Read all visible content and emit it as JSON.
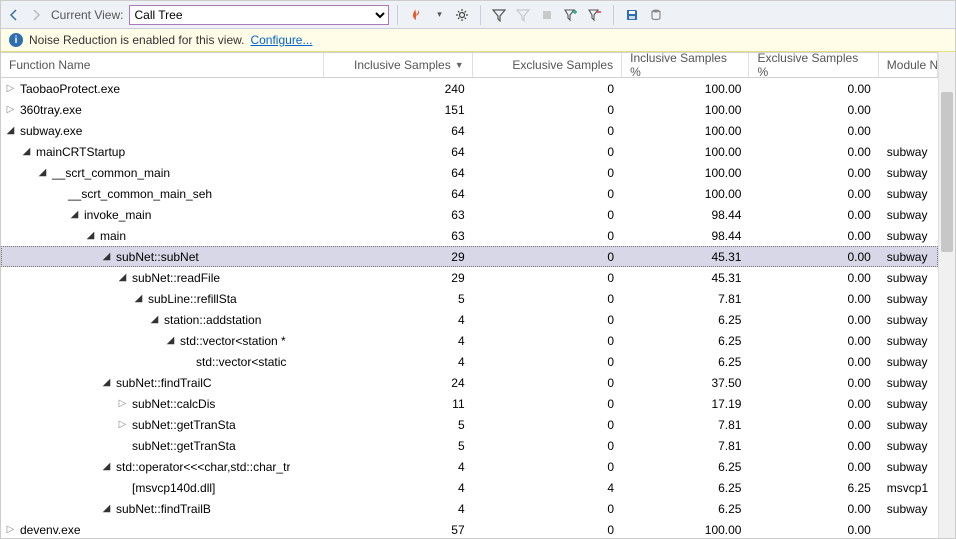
{
  "toolbar": {
    "current_view_label": "Current View:",
    "current_view_value": "Call Tree"
  },
  "notice": {
    "text": "Noise Reduction is enabled for this view.",
    "link": "Configure..."
  },
  "columns": {
    "fn": "Function Name",
    "inc": "Inclusive Samples",
    "exc": "Exclusive Samples",
    "incp": "Inclusive Samples %",
    "excp": "Exclusive Samples %",
    "mod": "Module N"
  },
  "rows": [
    {
      "depth": 0,
      "exp": "closed",
      "fn": "TaobaoProtect.exe",
      "inc": "240",
      "exc": "0",
      "incp": "100.00",
      "excp": "0.00",
      "mod": ""
    },
    {
      "depth": 0,
      "exp": "closed",
      "fn": "360tray.exe",
      "inc": "151",
      "exc": "0",
      "incp": "100.00",
      "excp": "0.00",
      "mod": ""
    },
    {
      "depth": 0,
      "exp": "open",
      "fn": "subway.exe",
      "inc": "64",
      "exc": "0",
      "incp": "100.00",
      "excp": "0.00",
      "mod": ""
    },
    {
      "depth": 1,
      "exp": "open",
      "fn": "mainCRTStartup",
      "inc": "64",
      "exc": "0",
      "incp": "100.00",
      "excp": "0.00",
      "mod": "subway"
    },
    {
      "depth": 2,
      "exp": "open",
      "fn": "__scrt_common_main",
      "inc": "64",
      "exc": "0",
      "incp": "100.00",
      "excp": "0.00",
      "mod": "subway"
    },
    {
      "depth": 3,
      "exp": "none",
      "fn": "__scrt_common_main_seh",
      "inc": "64",
      "exc": "0",
      "incp": "100.00",
      "excp": "0.00",
      "mod": "subway"
    },
    {
      "depth": 4,
      "exp": "open",
      "fn": "invoke_main",
      "inc": "63",
      "exc": "0",
      "incp": "98.44",
      "excp": "0.00",
      "mod": "subway"
    },
    {
      "depth": 5,
      "exp": "open",
      "fn": "main",
      "inc": "63",
      "exc": "0",
      "incp": "98.44",
      "excp": "0.00",
      "mod": "subway"
    },
    {
      "depth": 6,
      "exp": "open",
      "fn": "subNet::subNet",
      "inc": "29",
      "exc": "0",
      "incp": "45.31",
      "excp": "0.00",
      "mod": "subway",
      "sel": true
    },
    {
      "depth": 7,
      "exp": "open",
      "fn": "subNet::readFile",
      "inc": "29",
      "exc": "0",
      "incp": "45.31",
      "excp": "0.00",
      "mod": "subway"
    },
    {
      "depth": 8,
      "exp": "open",
      "fn": "subLine::refillSta",
      "inc": "5",
      "exc": "0",
      "incp": "7.81",
      "excp": "0.00",
      "mod": "subway"
    },
    {
      "depth": 9,
      "exp": "open",
      "fn": "station::addstation",
      "inc": "4",
      "exc": "0",
      "incp": "6.25",
      "excp": "0.00",
      "mod": "subway"
    },
    {
      "depth": 10,
      "exp": "open",
      "fn": "std::vector<station *",
      "inc": "4",
      "exc": "0",
      "incp": "6.25",
      "excp": "0.00",
      "mod": "subway"
    },
    {
      "depth": 11,
      "exp": "none",
      "fn": "std::vector<static",
      "inc": "4",
      "exc": "0",
      "incp": "6.25",
      "excp": "0.00",
      "mod": "subway"
    },
    {
      "depth": 6,
      "exp": "open",
      "fn": "subNet::findTrailC",
      "inc": "24",
      "exc": "0",
      "incp": "37.50",
      "excp": "0.00",
      "mod": "subway"
    },
    {
      "depth": 7,
      "exp": "closed",
      "fn": "subNet::calcDis",
      "inc": "11",
      "exc": "0",
      "incp": "17.19",
      "excp": "0.00",
      "mod": "subway"
    },
    {
      "depth": 7,
      "exp": "closed",
      "fn": "subNet::getTranSta",
      "inc": "5",
      "exc": "0",
      "incp": "7.81",
      "excp": "0.00",
      "mod": "subway"
    },
    {
      "depth": 7,
      "exp": "none",
      "fn": "subNet::getTranSta",
      "inc": "5",
      "exc": "0",
      "incp": "7.81",
      "excp": "0.00",
      "mod": "subway"
    },
    {
      "depth": 6,
      "exp": "open",
      "fn": "std::operator<<<char,std::char_tr",
      "inc": "4",
      "exc": "0",
      "incp": "6.25",
      "excp": "0.00",
      "mod": "subway"
    },
    {
      "depth": 7,
      "exp": "none",
      "fn": "[msvcp140d.dll]",
      "inc": "4",
      "exc": "4",
      "incp": "6.25",
      "excp": "6.25",
      "mod": "msvcp1"
    },
    {
      "depth": 6,
      "exp": "open",
      "fn": "subNet::findTrailB",
      "inc": "4",
      "exc": "0",
      "incp": "6.25",
      "excp": "0.00",
      "mod": "subway"
    },
    {
      "depth": 0,
      "exp": "closed",
      "fn": "devenv.exe",
      "inc": "57",
      "exc": "0",
      "incp": "100.00",
      "excp": "0.00",
      "mod": ""
    }
  ]
}
